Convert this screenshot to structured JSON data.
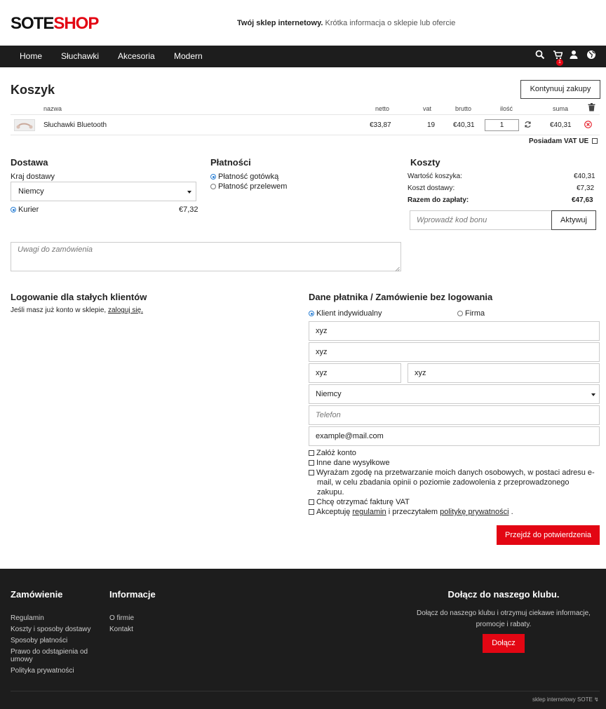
{
  "header": {
    "logo_part1": "SOTE",
    "logo_part2": "SHOP",
    "tagline_bold": "Twój sklep internetowy.",
    "tagline_rest": " Krótka informacja o sklepie lub ofercie"
  },
  "nav": {
    "items": [
      "Home",
      "Słuchawki",
      "Akcesoria",
      "Modern"
    ],
    "cart_count": "1",
    "icons": [
      "search-icon",
      "cart-icon",
      "user-icon",
      "globe-icon"
    ]
  },
  "cart": {
    "title": "Koszyk",
    "continue_label": "Kontynuuj zakupy",
    "columns": {
      "name": "nazwa",
      "netto": "netto",
      "vat": "vat",
      "brutto": "brutto",
      "qty": "ilość",
      "sum": "suma"
    },
    "rows": [
      {
        "name": "Słuchawki Bluetooth",
        "netto": "€33,87",
        "vat": "19",
        "brutto": "€40,31",
        "qty": "1",
        "sum": "€40,31"
      }
    ],
    "vat_eu_label": "Posiadam VAT UE"
  },
  "delivery": {
    "title": "Dostawa",
    "country_label": "Kraj dostawy",
    "country_value": "Niemcy",
    "option_label": "Kurier",
    "option_price": "€7,32"
  },
  "payment": {
    "title": "Płatności",
    "options": [
      "Płatność gotówką",
      "Płatność przelewem"
    ]
  },
  "costs": {
    "title": "Koszty",
    "cart_value_label": "Wartość koszyka:",
    "cart_value": "€40,31",
    "shipping_label": "Koszt dostawy:",
    "shipping_value": "€7,32",
    "total_label": "Razem do zapłaty:",
    "total_value": "€47,63",
    "coupon_placeholder": "Wprowadź kod bonu",
    "activate_label": "Aktywuj"
  },
  "notes": {
    "placeholder": "Uwagi do zamówienia"
  },
  "login": {
    "title": "Logowanie dla stałych klientów",
    "text": "Jeśli masz już konto w sklepie, ",
    "link": "zaloguj się."
  },
  "payer": {
    "title": "Dane płatnika / Zamówienie bez logowania",
    "type_individual": "Klient indywidualny",
    "type_company": "Firma",
    "field1": "xyz",
    "field2": "xyz",
    "field3": "xyz",
    "field4": "xyz",
    "country": "Niemcy",
    "phone_placeholder": "Telefon",
    "email": "example@mail.com",
    "check_account": "Załóż konto",
    "check_shipping": "Inne dane wysyłkowe",
    "check_consent": "Wyrażam zgodę na przetwarzanie moich danych osobowych, w postaci adresu e-mail, w celu zbadania opinii o poziomie zadowolenia z przeprowadzonego zakupu.",
    "check_invoice": "Chcę otrzymać fakturę VAT",
    "accept_prefix": "Akceptuję ",
    "accept_link1": "regulamin",
    "accept_middle": " i przeczytałem ",
    "accept_link2": "politykę prywatności",
    "accept_suffix": " .",
    "submit_label": "Przejdź do potwierdzenia"
  },
  "footer": {
    "col1_title": "Zamówienie",
    "col1_links": [
      "Regulamin",
      "Koszty i sposoby dostawy",
      "Sposoby płatności",
      "Prawo do odstąpienia od umowy",
      "Polityka prywatności"
    ],
    "col2_title": "Informacje",
    "col2_links": [
      "O firmie",
      "Kontakt"
    ],
    "club_title": "Dołącz do naszego klubu.",
    "club_text": "Dołącz do naszego klubu i otrzymuj ciekawe informacje, promocje i rabaty.",
    "club_button": "Dołącz",
    "credit": "sklep internetowy SOTE"
  },
  "colors": {
    "accent": "#e30613",
    "dark": "#1d1d1d",
    "radio": "#2a7fd4"
  }
}
